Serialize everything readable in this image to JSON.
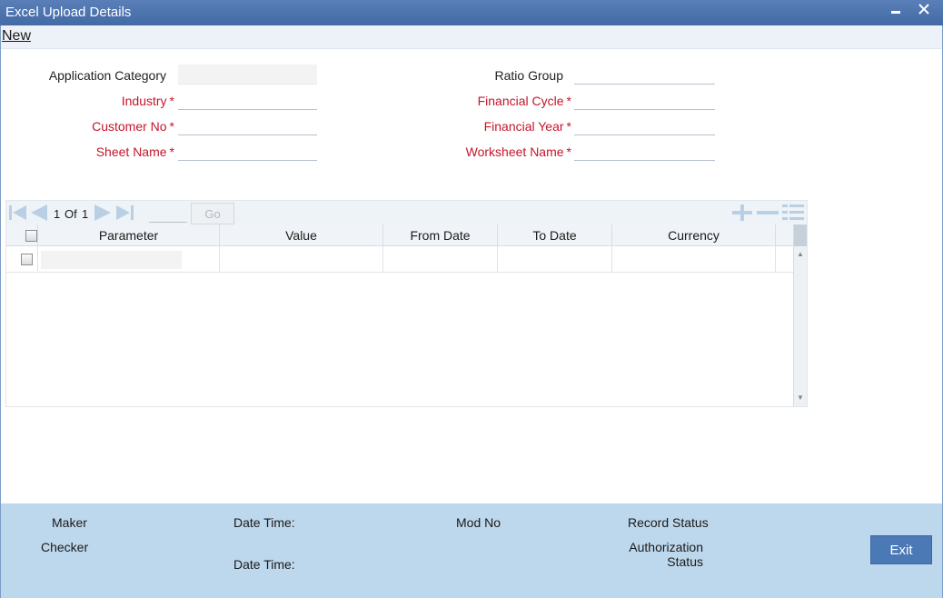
{
  "window": {
    "title": "Excel Upload Details",
    "minimize_glyph": "▄",
    "close_glyph": "✕"
  },
  "menu": {
    "new_label": "New"
  },
  "form": {
    "application_category": {
      "label": "Application Category",
      "value": ""
    },
    "industry": {
      "label": "Industry",
      "required_mark": "*",
      "value": ""
    },
    "customer_no": {
      "label": "Customer No",
      "required_mark": "*",
      "value": ""
    },
    "sheet_name": {
      "label": "Sheet Name",
      "required_mark": "*",
      "value": ""
    },
    "ratio_group": {
      "label": "Ratio Group",
      "value": ""
    },
    "financial_cycle": {
      "label": "Financial Cycle",
      "required_mark": "*",
      "value": ""
    },
    "financial_year": {
      "label": "Financial Year",
      "required_mark": "*",
      "value": ""
    },
    "worksheet_name": {
      "label": "Worksheet Name",
      "required_mark": "*",
      "value": ""
    }
  },
  "grid": {
    "page_current": "1",
    "page_of": "Of",
    "page_total": "1",
    "go_label": "Go",
    "columns": [
      "Parameter",
      "Value",
      "From Date",
      "To Date",
      "Currency"
    ],
    "rows": [
      {
        "parameter": "",
        "value": "",
        "from_date": "",
        "to_date": "",
        "currency": ""
      }
    ],
    "icons": [
      "first-page-icon",
      "prev-page-icon",
      "next-page-icon",
      "last-page-icon",
      "add-row-icon",
      "delete-row-icon",
      "view-rows-icon"
    ],
    "icon_color": "#b9cfe4"
  },
  "footer": {
    "maker_label": "Maker",
    "checker_label": "Checker",
    "date_time_label_1": "Date Time:",
    "date_time_label_2": "Date Time:",
    "mod_no_label": "Mod No",
    "record_status_label": "Record Status",
    "authorization_label_line1": "Authorization",
    "authorization_label_line2": "Status",
    "exit_label": "Exit"
  },
  "colors": {
    "title_bar": "#4a70aa",
    "required_label": "#c4162a",
    "footer_bg": "#bdd7ec",
    "exit_button": "#4b79b5"
  }
}
